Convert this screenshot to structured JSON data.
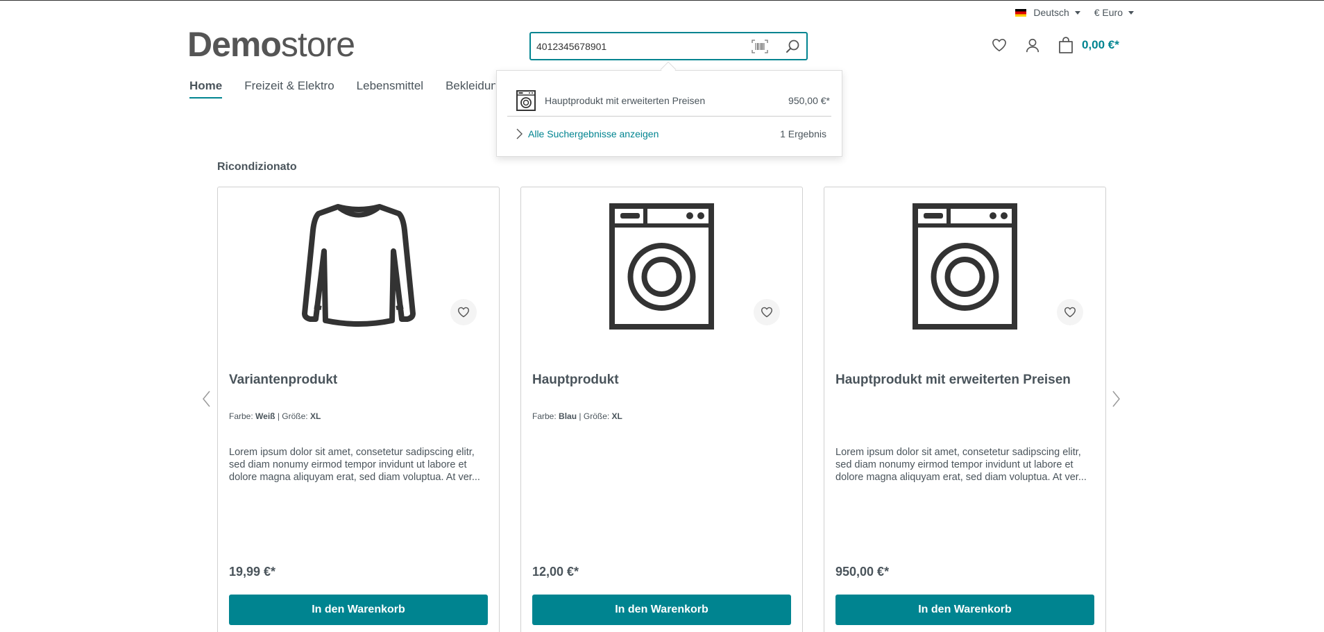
{
  "topbar": {
    "language": "Deutsch",
    "currency": "€ Euro"
  },
  "header": {
    "logo_bold": "Demo",
    "logo_light": "store",
    "search_value": "4012345678901",
    "cart_total": "0,00 €*"
  },
  "nav": {
    "items": [
      {
        "label": "Home",
        "active": true
      },
      {
        "label": "Freizeit & Elektro"
      },
      {
        "label": "Lebensmittel"
      },
      {
        "label": "Bekleidung"
      }
    ]
  },
  "search_dropdown": {
    "result_name": "Hauptprodukt mit erweiterten Preisen",
    "result_price": "950,00 €*",
    "all_results_label": "Alle Suchergebnisse anzeigen",
    "result_count": "1 Ergebnis"
  },
  "section": {
    "title": "Ricondizionato"
  },
  "products": [
    {
      "title": "Variantenprodukt",
      "icon": "shirt-icon",
      "prop1_label": "Farbe:",
      "prop1_value": "Weiß",
      "prop2_label": "Größe:",
      "prop2_value": "XL",
      "description": "Lorem ipsum dolor sit amet, consetetur sadipscing elitr, sed diam nonumy eirmod tempor invidunt ut labore et dolore magna aliquyam erat, sed diam voluptua. At ver...",
      "price": "19,99 €*",
      "button": "In den Warenkorb"
    },
    {
      "title": "Hauptprodukt",
      "icon": "washing-machine-icon",
      "prop1_label": "Farbe:",
      "prop1_value": "Blau",
      "prop2_label": "Größe:",
      "prop2_value": "XL",
      "description": "",
      "price": "12,00 €*",
      "button": "In den Warenkorb"
    },
    {
      "title": "Hauptprodukt mit erweiterten Preisen",
      "icon": "washing-machine-icon",
      "description": "Lorem ipsum dolor sit amet, consetetur sadipscing elitr, sed diam nonumy eirmod tempor invidunt ut labore et dolore magna aliquyam erat, sed diam voluptua. At ver...",
      "price": "950,00 €*",
      "button": "In den Warenkorb"
    }
  ],
  "colors": {
    "accent": "#008490",
    "text": "#4a545b"
  }
}
